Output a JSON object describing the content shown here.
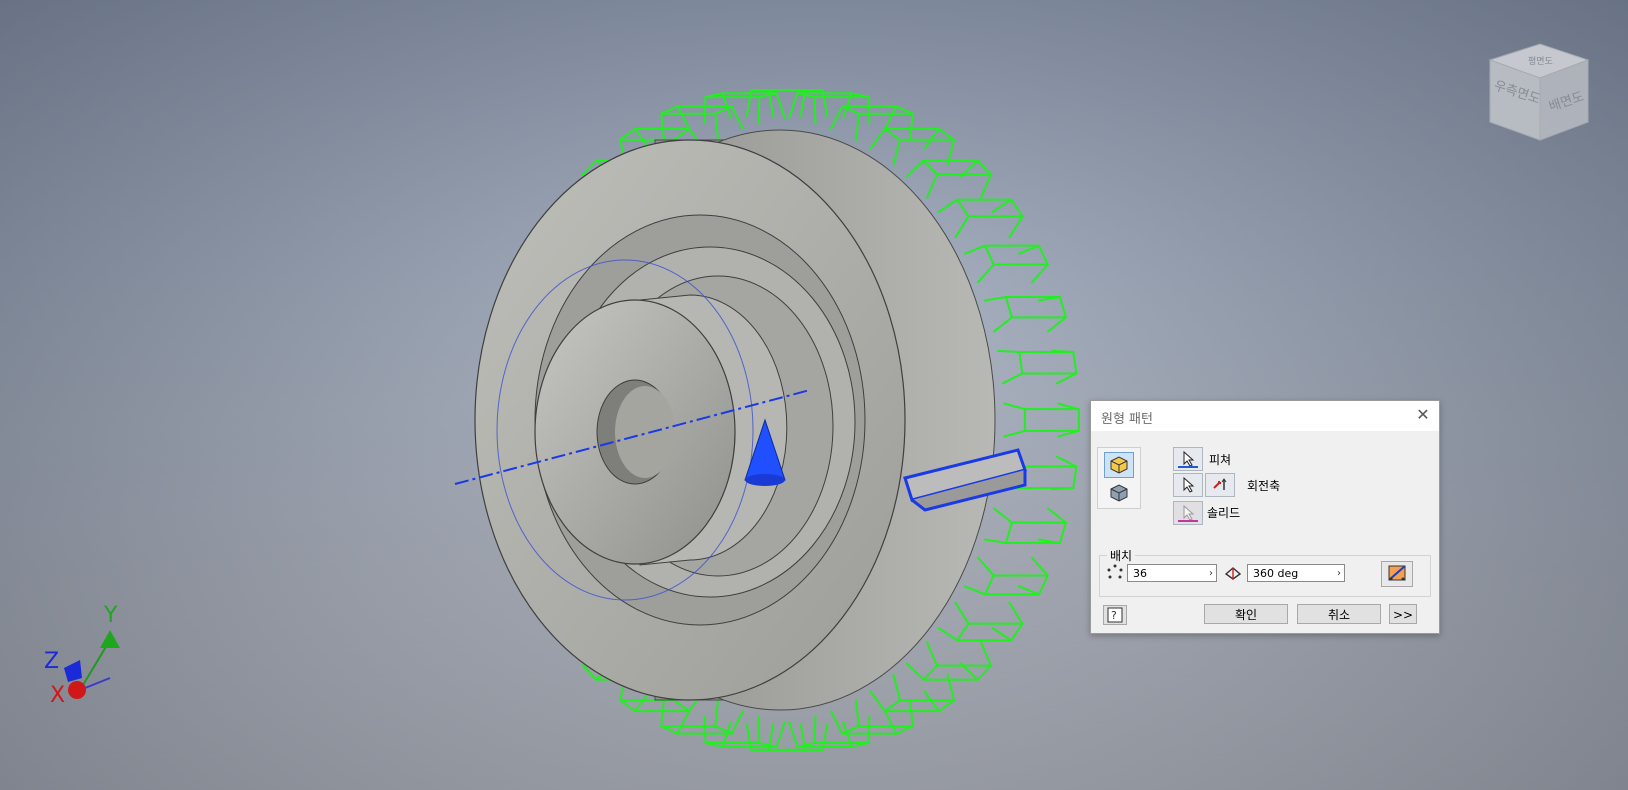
{
  "viewcube": {
    "face_front": "우측면도",
    "face_side": "배면도",
    "face_top": "평면도"
  },
  "axes": {
    "x": "X",
    "y": "Y",
    "z": "Z"
  },
  "dialog": {
    "title": "원형 패턴",
    "close_icon": "close-icon",
    "modes": [
      "pattern-solid-icon",
      "pattern-feature-icon"
    ],
    "feature_label": "피쳐",
    "axis_label": "회전축",
    "solid_label": "솔리드",
    "group_title": "배치",
    "count_value": "36",
    "angle_value": "360 deg",
    "ok_label": "확인",
    "cancel_label": "취소",
    "more_label": ">>",
    "colors": {
      "feature_underline": "#1f5ad9",
      "solid_underline": "#c0389a",
      "axis_arrow": "#d02020"
    }
  },
  "scene_colors": {
    "wireframe": "#22ee22",
    "selection": "#1a3ae6",
    "part": "#a9aaa5",
    "axis_line": "#1a3ae6"
  }
}
